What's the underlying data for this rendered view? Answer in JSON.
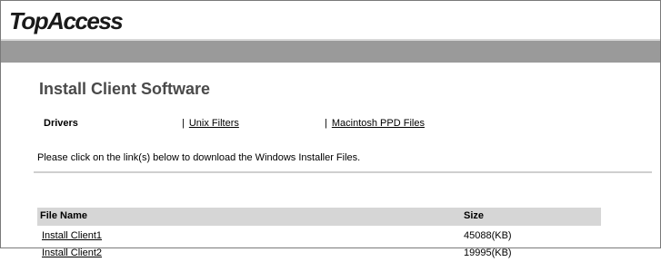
{
  "header": {
    "logo_text": "TopAccess"
  },
  "page": {
    "title": "Install Client Software"
  },
  "tabs": [
    {
      "label": "Drivers",
      "active": true
    },
    {
      "label": "Unix Filters",
      "active": false
    },
    {
      "label": "Macintosh PPD Files",
      "active": false
    }
  ],
  "tab_separator": "|",
  "instruction": "Please click on the link(s) below to download the Windows Installer Files.",
  "table": {
    "headers": {
      "file_name": "File Name",
      "size": "Size"
    },
    "rows": [
      {
        "file_name": "Install Client1",
        "size": "45088(KB)"
      },
      {
        "file_name": "Install Client2",
        "size": "19995(KB)"
      }
    ]
  },
  "colors": {
    "gray_bar": "#9a9a9a",
    "table_header_bg": "#d6d6d6",
    "title_text": "#4a4a4a"
  }
}
